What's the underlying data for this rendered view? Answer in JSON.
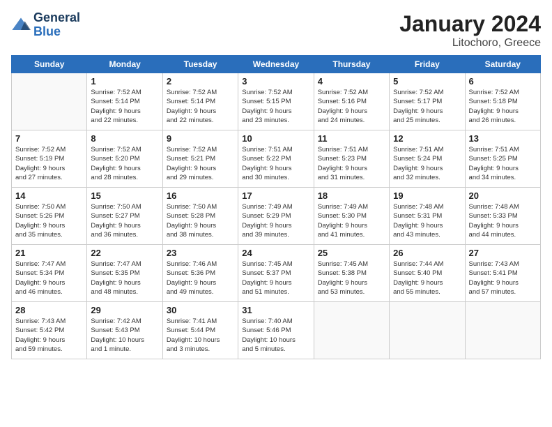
{
  "logo": {
    "text_general": "General",
    "text_blue": "Blue"
  },
  "title": "January 2024",
  "subtitle": "Litochoro, Greece",
  "days": [
    "Sunday",
    "Monday",
    "Tuesday",
    "Wednesday",
    "Thursday",
    "Friday",
    "Saturday"
  ],
  "weeks": [
    [
      {
        "date": "",
        "content": ""
      },
      {
        "date": "1",
        "content": "Sunrise: 7:52 AM\nSunset: 5:14 PM\nDaylight: 9 hours\nand 22 minutes."
      },
      {
        "date": "2",
        "content": "Sunrise: 7:52 AM\nSunset: 5:14 PM\nDaylight: 9 hours\nand 22 minutes."
      },
      {
        "date": "3",
        "content": "Sunrise: 7:52 AM\nSunset: 5:15 PM\nDaylight: 9 hours\nand 23 minutes."
      },
      {
        "date": "4",
        "content": "Sunrise: 7:52 AM\nSunset: 5:16 PM\nDaylight: 9 hours\nand 24 minutes."
      },
      {
        "date": "5",
        "content": "Sunrise: 7:52 AM\nSunset: 5:17 PM\nDaylight: 9 hours\nand 25 minutes."
      },
      {
        "date": "6",
        "content": "Sunrise: 7:52 AM\nSunset: 5:18 PM\nDaylight: 9 hours\nand 26 minutes."
      }
    ],
    [
      {
        "date": "7",
        "content": "Sunrise: 7:52 AM\nSunset: 5:19 PM\nDaylight: 9 hours\nand 27 minutes."
      },
      {
        "date": "8",
        "content": "Sunrise: 7:52 AM\nSunset: 5:20 PM\nDaylight: 9 hours\nand 28 minutes."
      },
      {
        "date": "9",
        "content": "Sunrise: 7:52 AM\nSunset: 5:21 PM\nDaylight: 9 hours\nand 29 minutes."
      },
      {
        "date": "10",
        "content": "Sunrise: 7:51 AM\nSunset: 5:22 PM\nDaylight: 9 hours\nand 30 minutes."
      },
      {
        "date": "11",
        "content": "Sunrise: 7:51 AM\nSunset: 5:23 PM\nDaylight: 9 hours\nand 31 minutes."
      },
      {
        "date": "12",
        "content": "Sunrise: 7:51 AM\nSunset: 5:24 PM\nDaylight: 9 hours\nand 32 minutes."
      },
      {
        "date": "13",
        "content": "Sunrise: 7:51 AM\nSunset: 5:25 PM\nDaylight: 9 hours\nand 34 minutes."
      }
    ],
    [
      {
        "date": "14",
        "content": "Sunrise: 7:50 AM\nSunset: 5:26 PM\nDaylight: 9 hours\nand 35 minutes."
      },
      {
        "date": "15",
        "content": "Sunrise: 7:50 AM\nSunset: 5:27 PM\nDaylight: 9 hours\nand 36 minutes."
      },
      {
        "date": "16",
        "content": "Sunrise: 7:50 AM\nSunset: 5:28 PM\nDaylight: 9 hours\nand 38 minutes."
      },
      {
        "date": "17",
        "content": "Sunrise: 7:49 AM\nSunset: 5:29 PM\nDaylight: 9 hours\nand 39 minutes."
      },
      {
        "date": "18",
        "content": "Sunrise: 7:49 AM\nSunset: 5:30 PM\nDaylight: 9 hours\nand 41 minutes."
      },
      {
        "date": "19",
        "content": "Sunrise: 7:48 AM\nSunset: 5:31 PM\nDaylight: 9 hours\nand 43 minutes."
      },
      {
        "date": "20",
        "content": "Sunrise: 7:48 AM\nSunset: 5:33 PM\nDaylight: 9 hours\nand 44 minutes."
      }
    ],
    [
      {
        "date": "21",
        "content": "Sunrise: 7:47 AM\nSunset: 5:34 PM\nDaylight: 9 hours\nand 46 minutes."
      },
      {
        "date": "22",
        "content": "Sunrise: 7:47 AM\nSunset: 5:35 PM\nDaylight: 9 hours\nand 48 minutes."
      },
      {
        "date": "23",
        "content": "Sunrise: 7:46 AM\nSunset: 5:36 PM\nDaylight: 9 hours\nand 49 minutes."
      },
      {
        "date": "24",
        "content": "Sunrise: 7:45 AM\nSunset: 5:37 PM\nDaylight: 9 hours\nand 51 minutes."
      },
      {
        "date": "25",
        "content": "Sunrise: 7:45 AM\nSunset: 5:38 PM\nDaylight: 9 hours\nand 53 minutes."
      },
      {
        "date": "26",
        "content": "Sunrise: 7:44 AM\nSunset: 5:40 PM\nDaylight: 9 hours\nand 55 minutes."
      },
      {
        "date": "27",
        "content": "Sunrise: 7:43 AM\nSunset: 5:41 PM\nDaylight: 9 hours\nand 57 minutes."
      }
    ],
    [
      {
        "date": "28",
        "content": "Sunrise: 7:43 AM\nSunset: 5:42 PM\nDaylight: 9 hours\nand 59 minutes."
      },
      {
        "date": "29",
        "content": "Sunrise: 7:42 AM\nSunset: 5:43 PM\nDaylight: 10 hours\nand 1 minute."
      },
      {
        "date": "30",
        "content": "Sunrise: 7:41 AM\nSunset: 5:44 PM\nDaylight: 10 hours\nand 3 minutes."
      },
      {
        "date": "31",
        "content": "Sunrise: 7:40 AM\nSunset: 5:46 PM\nDaylight: 10 hours\nand 5 minutes."
      },
      {
        "date": "",
        "content": ""
      },
      {
        "date": "",
        "content": ""
      },
      {
        "date": "",
        "content": ""
      }
    ]
  ]
}
